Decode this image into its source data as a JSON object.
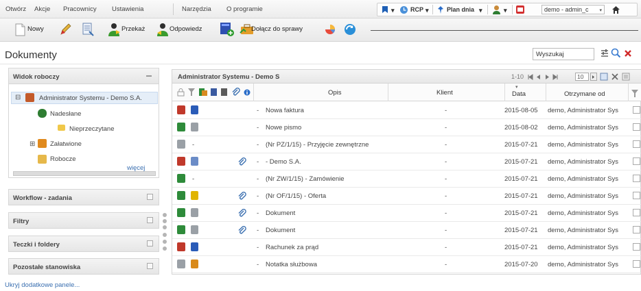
{
  "menu": [
    "Otwórz",
    "Akcje",
    "Pracownicy",
    "Ustawienia",
    "Narzędzia",
    "O programie"
  ],
  "topbar": {
    "rcp": "RCP",
    "plan": "Plan dnia",
    "user": "demo - admin_c",
    "dropdown": "▾"
  },
  "toolbar": {
    "new": "Nowy",
    "forward": "Przekaż",
    "reply": "Odpowiedz",
    "attach_case": "Dołącz do sprawy"
  },
  "page": {
    "title": "Dokumenty"
  },
  "search": {
    "value": "Wyszukaj"
  },
  "panels": {
    "working_view": "Widok roboczy",
    "workflow": "Workflow - zadania",
    "filters": "Filtry",
    "folders": "Teczki i foldery",
    "other": "Pozostałe stanowiska",
    "hide_link": "Ukryj dodatkowe panele..."
  },
  "tree": {
    "root": "Administrator Systemu - Demo S.A.",
    "items": [
      "Nadesłane",
      "Nieprzeczytane",
      "Załatwione",
      "Robocze"
    ],
    "more": "więcej",
    "expander": "⊟",
    "expander2": "⊞"
  },
  "grid": {
    "title": "Administrator Systemu - Demo S",
    "paging": "1-10",
    "page_size": "10",
    "columns": {
      "desc": "Opis",
      "client": "Klient",
      "date": "Data",
      "from": "Otrzymane od"
    },
    "rows": [
      {
        "id": "",
        "desc": "Nowa faktura",
        "client": "-",
        "date": "2015-08-05",
        "from": "demo, Administrator Sys",
        "dash": "-",
        "icon1": "#c0392b",
        "icon2": "#2a5cb8",
        "clip": false
      },
      {
        "id": "",
        "desc": "Nowe pismo",
        "client": "-",
        "date": "2015-08-02",
        "from": "demo, Administrator Sys",
        "dash": "-",
        "icon1": "#2e8b3a",
        "icon2": "#9aa0a6",
        "clip": false
      },
      {
        "id": "-",
        "desc": "(Nr PZ/1/15) - Przyjęcie zewnętrzne",
        "client": "-",
        "date": "2015-07-21",
        "from": "demo, Administrator Sys",
        "dash": "-",
        "icon1": "#9aa0a6",
        "icon2": "",
        "clip": false
      },
      {
        "id": "",
        "desc": "- Demo S.A.",
        "client": "-",
        "date": "2015-07-21",
        "from": "demo, Administrator Sys",
        "dash": "-",
        "icon1": "#c0392b",
        "icon2": "#6b8cc7",
        "clip": true
      },
      {
        "id": "-",
        "desc": "(Nr ZW/1/15) - Zamówienie",
        "client": "-",
        "date": "2015-07-21",
        "from": "demo, Administrator Sys",
        "dash": "-",
        "icon1": "#2e8b3a",
        "icon2": "",
        "clip": false
      },
      {
        "id": "",
        "desc": "(Nr OF/1/15) - Oferta",
        "client": "-",
        "date": "2015-07-21",
        "from": "demo, Administrator Sys",
        "dash": "-",
        "icon1": "#2e8b3a",
        "icon2": "#e0b400",
        "clip": true
      },
      {
        "id": "",
        "desc": "Dokument",
        "client": "-",
        "date": "2015-07-21",
        "from": "demo, Administrator Sys",
        "dash": "-",
        "icon1": "#2e8b3a",
        "icon2": "#9aa0a6",
        "clip": true
      },
      {
        "id": "",
        "desc": "Dokument",
        "client": "-",
        "date": "2015-07-21",
        "from": "demo, Administrator Sys",
        "dash": "-",
        "icon1": "#2e8b3a",
        "icon2": "#9aa0a6",
        "clip": true
      },
      {
        "id": "",
        "desc": "Rachunek za prąd",
        "client": "-",
        "date": "2015-07-21",
        "from": "demo, Administrator Sys",
        "dash": "-",
        "icon1": "#c0392b",
        "icon2": "#2a5cb8",
        "clip": false
      },
      {
        "id": "",
        "desc": "Notatka służbowa",
        "client": "-",
        "date": "2015-07-20",
        "from": "demo, Administrator Sys",
        "dash": "-",
        "icon1": "#9aa0a6",
        "icon2": "#d98a1a",
        "clip": false
      }
    ]
  }
}
